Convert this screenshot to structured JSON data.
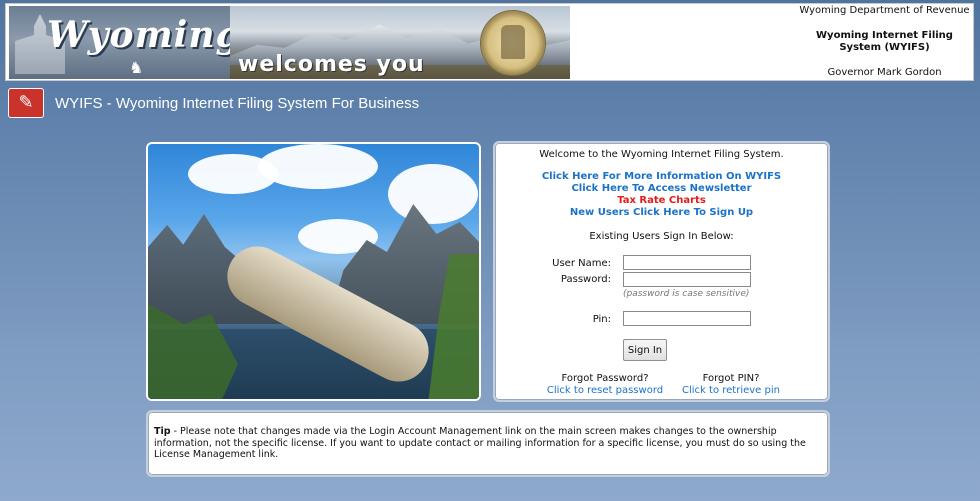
{
  "banner": {
    "logo_word": "Wyoming",
    "welcome_word": "welcomes you",
    "department": "Wyoming Department of Revenue",
    "system_line1": "Wyoming Internet Filing",
    "system_line2": "System (WYIFS)",
    "governor": "Governor Mark Gordon"
  },
  "header": {
    "title": "WYIFS - Wyoming Internet Filing System For Business"
  },
  "login": {
    "welcome": "Welcome to the Wyoming Internet Filing System.",
    "link_info": "Click Here For More Information On WYIFS",
    "link_newsletter": "Click Here To Access Newsletter",
    "link_tax_rates": "Tax Rate Charts",
    "link_signup": "New Users Click Here To Sign Up",
    "existing_users": "Existing Users Sign In Below:",
    "username_label": "User Name:",
    "username_value": "",
    "password_label": "Password:",
    "password_value": "",
    "password_hint": "(password is case sensitive)",
    "pin_label": "Pin:",
    "pin_value": "",
    "signin_button": "Sign In",
    "forgot_password_label": "Forgot Password?",
    "forgot_password_link": "Click to reset password",
    "forgot_pin_label": "Forgot PIN?",
    "forgot_pin_link": "Click to retrieve pin"
  },
  "tip": {
    "label": "Tip",
    "text": " - Please note that changes made via the Login Account Management link on the main screen makes changes to the ownership information, not the specific license. If you want to update contact or mailing information for a specific license, you must do so using the License Management link."
  },
  "colors": {
    "link_blue": "#1a73c9",
    "link_red": "#e21c1c",
    "background": "#6788b1"
  }
}
